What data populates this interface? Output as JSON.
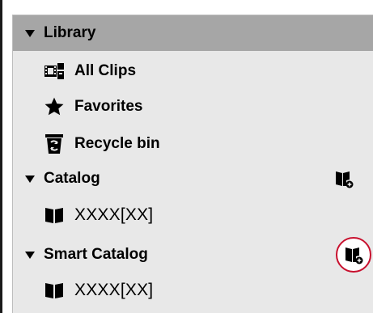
{
  "library": {
    "header_label": "Library",
    "items": [
      {
        "label": "All Clips",
        "icon": "all-clips-icon"
      },
      {
        "label": "Favorites",
        "icon": "star-icon"
      },
      {
        "label": "Recycle bin",
        "icon": "recycle-bin-icon"
      }
    ]
  },
  "catalog": {
    "header_label": "Catalog",
    "add_icon": "add-catalog-icon",
    "items": [
      {
        "label": "XXXX[XX]",
        "icon": "book-icon"
      }
    ]
  },
  "smart_catalog": {
    "header_label": "Smart Catalog",
    "add_icon": "add-smart-catalog-icon",
    "items": [
      {
        "label": "XXXX[XX]",
        "icon": "book-icon"
      }
    ]
  },
  "colors": {
    "panel_bg": "#e8e8e8",
    "selected_header_bg": "#a6a6a6",
    "highlight_ring": "#c8102e"
  }
}
